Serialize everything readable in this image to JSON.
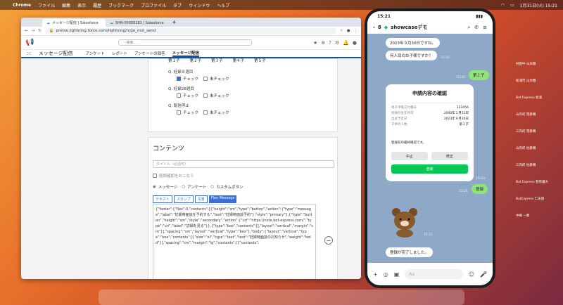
{
  "menubar": {
    "apple": "",
    "app": "Chrome",
    "items": [
      "ファイル",
      "編集",
      "表示",
      "履歴",
      "ブックマーク",
      "プロファイル",
      "タブ",
      "ウィンドウ",
      "ヘルプ"
    ],
    "clock": "1月31日(火) 15:21"
  },
  "browser": {
    "tabs": [
      {
        "label": "メッセージ配信 | Salesforce"
      },
      {
        "label": "SHN-00000181 | Salesforce"
      }
    ],
    "url": "pretso.lightning.force.com/lightning/n/ge_mst_send",
    "search_placeholder": "検索...",
    "app_name": "メッセージ配信",
    "nav": [
      "アンケート",
      "レポート",
      "アンケートの回答",
      "メッセージ配信"
    ]
  },
  "survey": {
    "row_labels": [
      "第１子",
      "第２子",
      "第３子",
      "第４子",
      "第５子"
    ],
    "q1": "Q. 妊娠８週目",
    "q2": "Q. 妊娠28週目",
    "q3": "Q. 配信停止",
    "check": "チェック",
    "uncheck": "未チェック"
  },
  "contents": {
    "title": "コンテンツ",
    "title_placeholder": "タイトル（必須可）",
    "confirm": "既読確認をおこなう",
    "types": [
      "メッセージ",
      "アンケート",
      "カスタムボタン"
    ],
    "subtabs": [
      "テキスト",
      "スタンプ",
      "写真",
      "Flex Message"
    ],
    "json": "{\"footer\":{\"flex\":0,\"contents\":[{\"height\":\"sm\",\"type\":\"button\",\"action\":{\"type\":\"message\",\"label\":\"妊娠時面談を予約する\",\"text\":\"妊娠時面談予約\"},\"style\":\"primary\"},{\"type\":\"button\",\"height\":\"sm\",\"style\":\"secondary\",\"action\":{\"uri\":\"https://note.bot-express.com/\",\"type\":\"uri\",\"label\":\"詳細を見る\"}},{\"type\":\"box\",\"contents\":[],\"layout\":\"vertical\",\"margin\":\"sm\"}],\"spacing\":\"sm\",\"layout\":\"vertical\",\"type\":\"box\"},\"body\":{\"layout\":\"vertical\",\"type\":\"box\",\"contents\":[{\"size\":\"xl\",\"type\":\"text\",\"text\":\"妊娠時面談のお知らせ\",\"weight\":\"bold\"}],\"spacing\":\"sm\",\"margin\":\"lg\",\"contents\":[{\"contents\":"
  },
  "phone": {
    "time": "15:21",
    "back_count": "8",
    "chat_title": "showcaseデモ",
    "msg1": "2023年９月30日ですね。",
    "msg2": "何人目のお子様ですか？",
    "reply1": "第１子",
    "card_title": "申請内容の確認",
    "rows": [
      [
        "母子手帳交付番号",
        "123456"
      ],
      [
        "妊婦の生年月日",
        "2000年１月31日"
      ],
      [
        "出産予定日",
        "2023年９月30日"
      ],
      [
        "子供の人数",
        "第１子"
      ]
    ],
    "card_note": "登録前の最終確認です。",
    "btn_cancel": "中止",
    "btn_fix": "修正",
    "btn_register": "登録",
    "reply2": "登録",
    "done": "登録が完了しました。",
    "input_placeholder": "Aa",
    "ts1": "15:20",
    "ts2": "15:20",
    "ts3": "15:20",
    "ts4": "15:21",
    "ts5": "15:21"
  },
  "participants": [
    "村田中 山本機",
    "松浦市 山本機",
    "Bot Express 松浦",
    "山内町 雪薪機",
    "三内町 雪薪機",
    "山内町 佐薪機",
    "三内町 佐薪機",
    "Bot Express 菅原議大",
    "BotExpress 仁志田",
    "中嶋 一教"
  ]
}
